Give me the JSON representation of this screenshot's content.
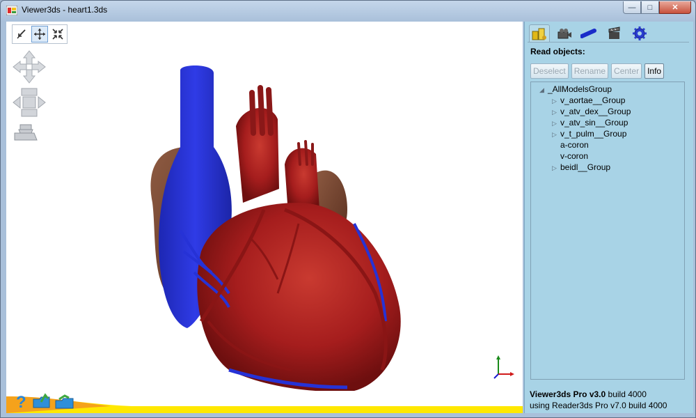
{
  "window": {
    "title": "Viewer3ds - heart1.3ds",
    "minimize_glyph": "—",
    "maximize_glyph": "□",
    "close_glyph": "✕"
  },
  "viewport": {
    "toolbar": [
      {
        "name": "select-tool",
        "icon": "pointer-arrow-icon",
        "active": false
      },
      {
        "name": "pan-tool",
        "icon": "move-arrows-icon",
        "active": true
      },
      {
        "name": "zoom-extents-tool",
        "icon": "collapse-arrows-icon",
        "active": false
      }
    ],
    "bottom_icons": [
      "help-icon",
      "open-folder-icon",
      "save-folder-icon"
    ]
  },
  "panel": {
    "tabs": [
      {
        "icon": "objects-tab-icon",
        "active": true
      },
      {
        "icon": "camera-tab-icon",
        "active": false
      },
      {
        "icon": "light-tab-icon",
        "active": false
      },
      {
        "icon": "animation-tab-icon",
        "active": false
      },
      {
        "icon": "settings-gear-icon",
        "active": false
      }
    ],
    "read_objects_label": "Read objects:",
    "buttons": {
      "deselect": "Deselect",
      "rename": "Rename",
      "center": "Center",
      "info": "Info"
    },
    "tree": [
      {
        "label": "_AllModelsGroup",
        "level": 0,
        "expander": "◢"
      },
      {
        "label": "v_aortae__Group",
        "level": 1,
        "expander": "▷"
      },
      {
        "label": "v_atv_dex__Group",
        "level": 1,
        "expander": "▷"
      },
      {
        "label": "v_atv_sin__Group",
        "level": 1,
        "expander": "▷"
      },
      {
        "label": "v_t_pulm__Group",
        "level": 1,
        "expander": "▷"
      },
      {
        "label": "a-coron",
        "level": 1,
        "expander": ""
      },
      {
        "label": "v-coron",
        "level": 1,
        "expander": ""
      },
      {
        "label": "beidl__Group",
        "level": 1,
        "expander": "▷"
      }
    ],
    "status": {
      "product": "Viewer3ds Pro v3.0",
      "build": " build 4000",
      "reader": "using Reader3ds Pro v7.0 build 4000"
    }
  },
  "colors": {
    "heart_red": "#a51d1d",
    "vein_blue": "#2632d6",
    "panel_bg": "#a8d3e6",
    "band_yellow": "#ffe800"
  }
}
